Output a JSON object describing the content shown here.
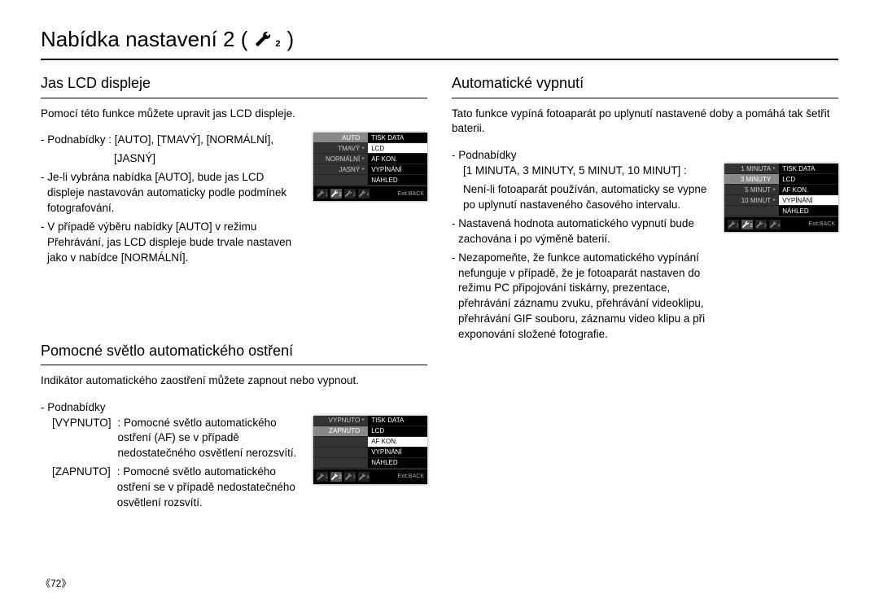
{
  "page": {
    "title_prefix": "Nabídka nastavení 2 (",
    "title_suffix": ")",
    "wrench_sub": "2",
    "number": "《72》"
  },
  "left": {
    "s1": {
      "heading": "Jas LCD displeje",
      "intro": "Pomocí této funkce můžete upravit jas LCD displeje.",
      "p1": "- Podnabídky : [AUTO], [TMAVÝ], [NORMÁLNÍ],",
      "p1b": "[JASNÝ]",
      "p2": "- Je-li vybrána nabídka [AUTO], bude jas LCD displeje nastavován automaticky podle podmínek fotografování.",
      "p3": "- V případě výběru nabídky [AUTO] v režimu Přehrávání, jas LCD displeje bude trvale nastaven jako v nabídce [NORMÁLNÍ].",
      "cam": {
        "left": [
          "AUTO",
          "TMAVÝ",
          "NORMÁLNÍ",
          "JASNÝ",
          ""
        ],
        "right": [
          "TISK DATA",
          "LCD",
          "AF KON.",
          "VYPÍNÁNÍ",
          "NÁHLED"
        ],
        "leftSel": 0,
        "rightSel": 1,
        "exit": "Exit:BACK"
      }
    },
    "s2": {
      "heading": "Pomocné světlo automatického ostření",
      "intro": "Indikátor automatického zaostření můžete zapnout nebo vypnout.",
      "p0": "- Podnabídky",
      "row1_term": "[VYPNUTO]",
      "row1_desc": ": Pomocné světlo automatického ostření (AF) se v případě nedostatečného osvětlení nerozsvítí.",
      "row2_term": "[ZAPNUTO]",
      "row2_desc": ": Pomocné světlo automatického ostření se v případě nedostatečného osvětlení rozsvítí.",
      "cam": {
        "left": [
          "VYPNUTO",
          "ZAPNUTO",
          "",
          "",
          ""
        ],
        "right": [
          "TISK DATA",
          "LCD",
          "AF KON.",
          "VYPÍNÁNÍ",
          "NÁHLED"
        ],
        "leftSel": 1,
        "rightSel": 2,
        "exit": "Exit:BACK"
      }
    }
  },
  "right": {
    "s1": {
      "heading": "Automatické vypnutí",
      "intro": "Tato funkce vypíná fotoaparát po uplynutí nastavené doby a pomáhá tak šetřit baterii.",
      "p0": "- Podnabídky",
      "p1": "[1 MINUTA, 3 MINUTY, 5 MINUT, 10 MINUT] :",
      "p1b": "Není-li fotoaparát používán, automaticky se vypne po uplynutí nastaveného časového intervalu.",
      "p2": "- Nastavená hodnota automatického vypnutí bude zachována i po výměně baterií.",
      "p3": "- Nezapomeňte, že funkce automatického vypínání nefunguje v případě, že je fotoaparát nastaven do režimu PC připojování tiskárny, prezentace, přehrávání záznamu zvuku, přehrávání videoklipu, přehrávání GIF souboru, záznamu video klipu a při exponování složené fotografie.",
      "cam": {
        "left": [
          "1 MINUTA",
          "3 MINUTY",
          "5 MINUT",
          "10 MINUT",
          ""
        ],
        "right": [
          "TISK DATA",
          "LCD",
          "AF KON.",
          "VYPÍNÁNÍ",
          "NÁHLED"
        ],
        "leftSel": 1,
        "rightSel": 3,
        "exit": "Exit:BACK"
      }
    }
  }
}
